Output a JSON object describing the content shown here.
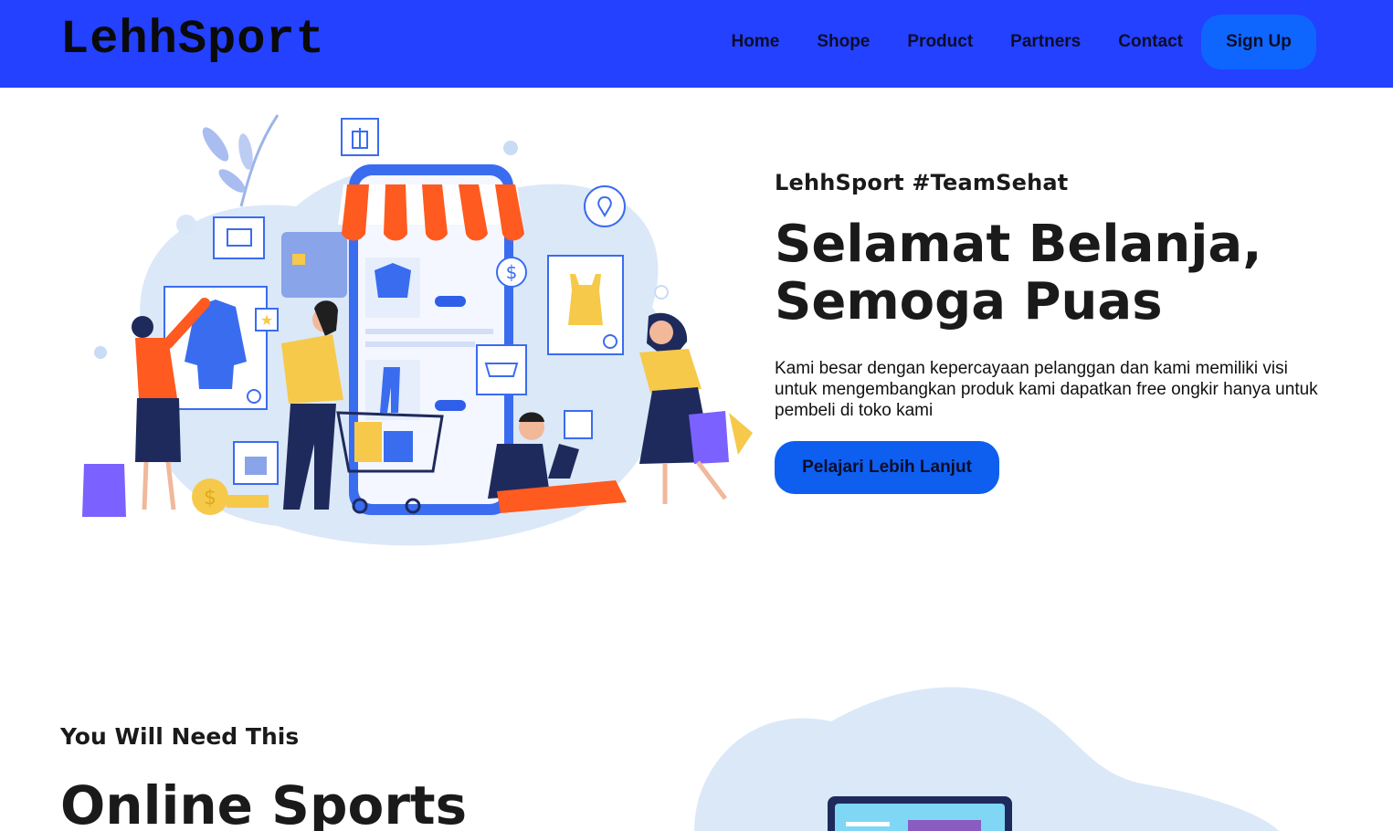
{
  "nav": {
    "brand": "LehhSport",
    "links": [
      "Home",
      "Shope",
      "Product",
      "Partners",
      "Contact"
    ],
    "signup": "Sign Up"
  },
  "hero": {
    "tagline": "LehhSport #TeamSehat",
    "headline_line1": "Selamat Belanja,",
    "headline_line2": "Semoga Puas",
    "description": "Kami besar dengan kepercayaan pelanggan dan kami memiliki visi untuk mengembangkan produk kami dapatkan free ongkir hanya untuk pembeli di toko kami",
    "cta": "Pelajari Lebih Lanjut"
  },
  "section2": {
    "tag": "You Will Need This",
    "title": "Online Sports"
  },
  "colors": {
    "navbar": "#2341ff",
    "button": "#0e66ff",
    "accent_orange": "#ff5a1f",
    "accent_yellow": "#f6c94a",
    "blob": "#dbe8f8"
  }
}
